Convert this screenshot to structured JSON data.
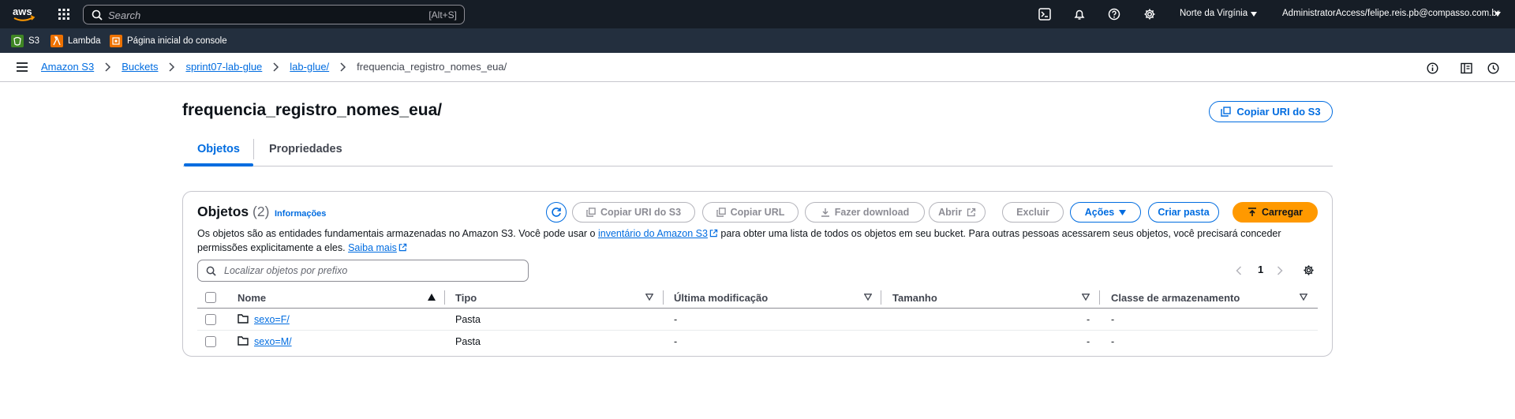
{
  "topnav": {
    "logo_text": "aws",
    "search_placeholder": "Search",
    "search_shortcut": "[Alt+S]",
    "region": "Norte da Virgínia",
    "account": "AdministratorAccess/felipe.reis.pb@compasso.com.br",
    "icons": [
      "cloudshell-icon",
      "bell-icon",
      "help-icon",
      "gear-icon"
    ]
  },
  "favorites": [
    {
      "label": "S3",
      "color": "#3f8624"
    },
    {
      "label": "Lambda",
      "color": "#ed7100"
    },
    {
      "label": "Página inicial do console",
      "color": "#ed7100"
    }
  ],
  "breadcrumb": {
    "items": [
      "Amazon S3",
      "Buckets",
      "sprint07-lab-glue",
      "lab-glue/"
    ],
    "current": "frequencia_registro_nomes_eua/"
  },
  "page": {
    "title": "frequencia_registro_nomes_eua/",
    "copy_uri_button": "Copiar URI do S3"
  },
  "tabs": [
    "Objetos",
    "Propriedades"
  ],
  "objects": {
    "title": "Objetos",
    "count": "(2)",
    "info_link": "Informações",
    "description_pre": "Os objetos são as entidades fundamentais armazenadas no Amazon S3. Você pode usar o ",
    "inventory_link": "inventário do Amazon S3",
    "description_mid": " para obter uma lista de todos os objetos em seu bucket. Para outras pessoas acessarem seus objetos, você precisará conceder permissões explicitamente a eles. ",
    "learn_more_link": "Saiba mais",
    "buttons": {
      "copy_uri": "Copiar URI do S3",
      "copy_url": "Copiar URL",
      "download": "Fazer download",
      "open": "Abrir",
      "delete": "Excluir",
      "actions": "Ações",
      "create_folder": "Criar pasta",
      "upload": "Carregar"
    },
    "filter_placeholder": "Localizar objetos por prefixo",
    "page_number": "1",
    "columns": [
      "Nome",
      "Tipo",
      "Última modificação",
      "Tamanho",
      "Classe de armazenamento"
    ],
    "rows": [
      {
        "name": "sexo=F/",
        "type": "Pasta",
        "modified": "-",
        "size": "-",
        "storage_class": "-"
      },
      {
        "name": "sexo=M/",
        "type": "Pasta",
        "modified": "-",
        "size": "-",
        "storage_class": "-"
      }
    ]
  },
  "colors": {
    "nav_bg": "#161d26",
    "fav_bg": "#232f3e",
    "link": "#006ce0",
    "upload_orange": "#ff9900"
  }
}
